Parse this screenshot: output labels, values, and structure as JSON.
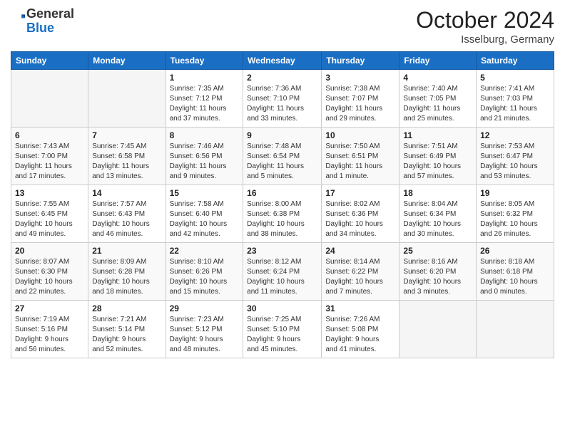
{
  "header": {
    "logo_general": "General",
    "logo_blue": "Blue",
    "month_title": "October 2024",
    "location": "Isselburg, Germany"
  },
  "days_of_week": [
    "Sunday",
    "Monday",
    "Tuesday",
    "Wednesday",
    "Thursday",
    "Friday",
    "Saturday"
  ],
  "weeks": [
    [
      {
        "day": "",
        "info": ""
      },
      {
        "day": "",
        "info": ""
      },
      {
        "day": "1",
        "info": "Sunrise: 7:35 AM\nSunset: 7:12 PM\nDaylight: 11 hours\nand 37 minutes."
      },
      {
        "day": "2",
        "info": "Sunrise: 7:36 AM\nSunset: 7:10 PM\nDaylight: 11 hours\nand 33 minutes."
      },
      {
        "day": "3",
        "info": "Sunrise: 7:38 AM\nSunset: 7:07 PM\nDaylight: 11 hours\nand 29 minutes."
      },
      {
        "day": "4",
        "info": "Sunrise: 7:40 AM\nSunset: 7:05 PM\nDaylight: 11 hours\nand 25 minutes."
      },
      {
        "day": "5",
        "info": "Sunrise: 7:41 AM\nSunset: 7:03 PM\nDaylight: 11 hours\nand 21 minutes."
      }
    ],
    [
      {
        "day": "6",
        "info": "Sunrise: 7:43 AM\nSunset: 7:00 PM\nDaylight: 11 hours\nand 17 minutes."
      },
      {
        "day": "7",
        "info": "Sunrise: 7:45 AM\nSunset: 6:58 PM\nDaylight: 11 hours\nand 13 minutes."
      },
      {
        "day": "8",
        "info": "Sunrise: 7:46 AM\nSunset: 6:56 PM\nDaylight: 11 hours\nand 9 minutes."
      },
      {
        "day": "9",
        "info": "Sunrise: 7:48 AM\nSunset: 6:54 PM\nDaylight: 11 hours\nand 5 minutes."
      },
      {
        "day": "10",
        "info": "Sunrise: 7:50 AM\nSunset: 6:51 PM\nDaylight: 11 hours\nand 1 minute."
      },
      {
        "day": "11",
        "info": "Sunrise: 7:51 AM\nSunset: 6:49 PM\nDaylight: 10 hours\nand 57 minutes."
      },
      {
        "day": "12",
        "info": "Sunrise: 7:53 AM\nSunset: 6:47 PM\nDaylight: 10 hours\nand 53 minutes."
      }
    ],
    [
      {
        "day": "13",
        "info": "Sunrise: 7:55 AM\nSunset: 6:45 PM\nDaylight: 10 hours\nand 49 minutes."
      },
      {
        "day": "14",
        "info": "Sunrise: 7:57 AM\nSunset: 6:43 PM\nDaylight: 10 hours\nand 46 minutes."
      },
      {
        "day": "15",
        "info": "Sunrise: 7:58 AM\nSunset: 6:40 PM\nDaylight: 10 hours\nand 42 minutes."
      },
      {
        "day": "16",
        "info": "Sunrise: 8:00 AM\nSunset: 6:38 PM\nDaylight: 10 hours\nand 38 minutes."
      },
      {
        "day": "17",
        "info": "Sunrise: 8:02 AM\nSunset: 6:36 PM\nDaylight: 10 hours\nand 34 minutes."
      },
      {
        "day": "18",
        "info": "Sunrise: 8:04 AM\nSunset: 6:34 PM\nDaylight: 10 hours\nand 30 minutes."
      },
      {
        "day": "19",
        "info": "Sunrise: 8:05 AM\nSunset: 6:32 PM\nDaylight: 10 hours\nand 26 minutes."
      }
    ],
    [
      {
        "day": "20",
        "info": "Sunrise: 8:07 AM\nSunset: 6:30 PM\nDaylight: 10 hours\nand 22 minutes."
      },
      {
        "day": "21",
        "info": "Sunrise: 8:09 AM\nSunset: 6:28 PM\nDaylight: 10 hours\nand 18 minutes."
      },
      {
        "day": "22",
        "info": "Sunrise: 8:10 AM\nSunset: 6:26 PM\nDaylight: 10 hours\nand 15 minutes."
      },
      {
        "day": "23",
        "info": "Sunrise: 8:12 AM\nSunset: 6:24 PM\nDaylight: 10 hours\nand 11 minutes."
      },
      {
        "day": "24",
        "info": "Sunrise: 8:14 AM\nSunset: 6:22 PM\nDaylight: 10 hours\nand 7 minutes."
      },
      {
        "day": "25",
        "info": "Sunrise: 8:16 AM\nSunset: 6:20 PM\nDaylight: 10 hours\nand 3 minutes."
      },
      {
        "day": "26",
        "info": "Sunrise: 8:18 AM\nSunset: 6:18 PM\nDaylight: 10 hours\nand 0 minutes."
      }
    ],
    [
      {
        "day": "27",
        "info": "Sunrise: 7:19 AM\nSunset: 5:16 PM\nDaylight: 9 hours\nand 56 minutes."
      },
      {
        "day": "28",
        "info": "Sunrise: 7:21 AM\nSunset: 5:14 PM\nDaylight: 9 hours\nand 52 minutes."
      },
      {
        "day": "29",
        "info": "Sunrise: 7:23 AM\nSunset: 5:12 PM\nDaylight: 9 hours\nand 48 minutes."
      },
      {
        "day": "30",
        "info": "Sunrise: 7:25 AM\nSunset: 5:10 PM\nDaylight: 9 hours\nand 45 minutes."
      },
      {
        "day": "31",
        "info": "Sunrise: 7:26 AM\nSunset: 5:08 PM\nDaylight: 9 hours\nand 41 minutes."
      },
      {
        "day": "",
        "info": ""
      },
      {
        "day": "",
        "info": ""
      }
    ]
  ]
}
